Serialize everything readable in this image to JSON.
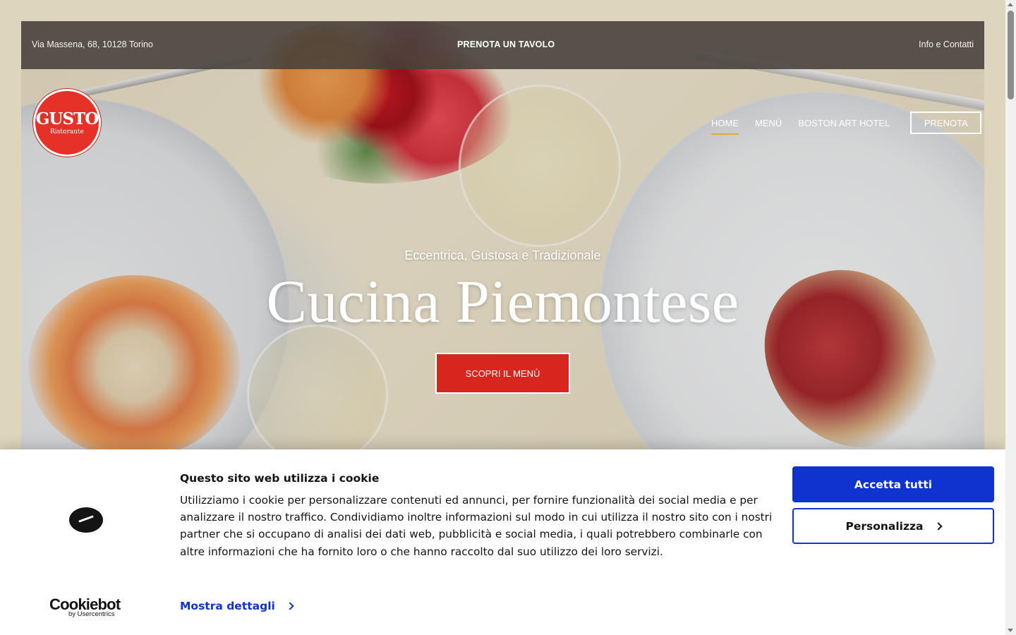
{
  "topbar": {
    "address": "Via Massena, 68, 10128 Torino",
    "book_table": "PRENOTA UN TAVOLO",
    "info": "Info e Contatti"
  },
  "logo": {
    "name": "GUSTO",
    "subtitle": "Ristorante"
  },
  "nav": {
    "items": [
      {
        "label": "HOME",
        "active": true
      },
      {
        "label": "MENÙ",
        "active": false
      },
      {
        "label": "BOSTON ART HOTEL",
        "active": false
      }
    ],
    "cta": "PRENOTA"
  },
  "hero": {
    "tagline": "Eccentrica, Gustosa e Tradizionale",
    "headline": "Cucina Piemontese",
    "button": "SCOPRI IL MENÙ"
  },
  "cookie": {
    "title": "Questo sito web utilizza i cookie",
    "body": "Utilizziamo i cookie per personalizzare contenuti ed annunci, per fornire funzionalità dei social media e per analizzare il nostro traffico. Condividiamo inoltre informazioni sul modo in cui utilizza il nostro sito con i nostri partner che si occupano di analisi dei dati web, pubblicità e social media, i quali potrebbero combinarle con altre informazioni che ha fornito loro o che hanno raccolto dal suo utilizzo dei loro servizi.",
    "details_link": "Mostra dettagli",
    "accept_button": "Accetta tutti",
    "customize_button": "Personalizza",
    "brand_name": "Cookiebot",
    "brand_by": "by Usercentrics"
  },
  "colors": {
    "page_background": "#ddd6bc",
    "brand_red": "#e53127",
    "button_red": "#d8261f",
    "cookie_blue": "#1032cf",
    "nav_active_underline": "#e0a93a"
  },
  "icons": {
    "cookiebot": "cookiebot-logo-icon",
    "details_chevron": "chevron-right-icon",
    "customize_chevron": "chevron-right-icon"
  }
}
